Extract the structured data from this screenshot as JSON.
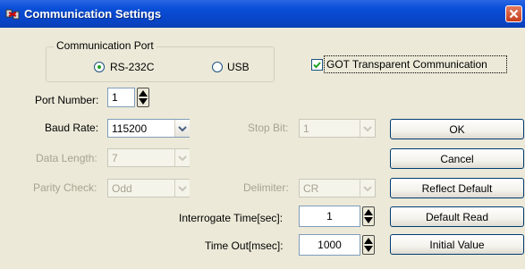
{
  "window": {
    "title": "Communication Settings"
  },
  "comm_port": {
    "legend": "Communication Port",
    "options": [
      {
        "label": "RS-232C",
        "selected": true
      },
      {
        "label": "USB",
        "selected": false
      }
    ]
  },
  "got_transparent": {
    "label": "GOT Transparent Communication",
    "checked": true
  },
  "port_number": {
    "label": "Port Number:",
    "value": "1"
  },
  "baud_rate": {
    "label": "Baud Rate:",
    "value": "115200"
  },
  "stop_bit": {
    "label": "Stop Bit:",
    "value": "1"
  },
  "data_length": {
    "label": "Data Length:",
    "value": "7"
  },
  "parity_check": {
    "label": "Parity Check:",
    "value": "Odd"
  },
  "delimiter": {
    "label": "Delimiter:",
    "value": "CR"
  },
  "interrogate_time": {
    "label": "Interrogate Time[sec]:",
    "value": "1"
  },
  "time_out": {
    "label": "Time Out[msec]:",
    "value": "1000"
  },
  "buttons": {
    "ok": "OK",
    "cancel": "Cancel",
    "reflect_default": "Reflect Default",
    "default_read": "Default Read",
    "initial_value": "Initial Value"
  },
  "colors": {
    "titlebar": "#0a4fd8",
    "face": "#ece9d8",
    "disabled_text": "#a6a391"
  },
  "icons": [
    "app-icon",
    "close-icon",
    "dropdown-arrow-icon",
    "spin-arrow-icon",
    "check-icon"
  ]
}
